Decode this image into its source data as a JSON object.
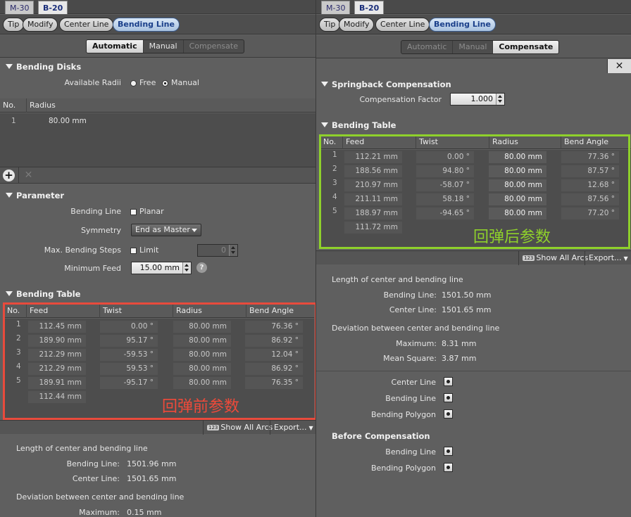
{
  "tabs": [
    "M-30",
    "B-20"
  ],
  "toolbar": [
    "Tip",
    "Modify",
    "Center Line",
    "Bending Line"
  ],
  "modes": [
    "Automatic",
    "Manual",
    "Compensate"
  ],
  "left": {
    "bending_disks": {
      "title": "Bending Disks",
      "available_radii_label": "Available Radii",
      "free_label": "Free",
      "manual_label": "Manual",
      "selected": "Manual",
      "columns": [
        "No.",
        "Radius"
      ],
      "rows": [
        {
          "no": "1",
          "radius": "80.00 mm"
        }
      ]
    },
    "parameter": {
      "title": "Parameter",
      "bending_line_label": "Bending Line",
      "planar_label": "Planar",
      "symmetry_label": "Symmetry",
      "symmetry_value": "End as Master",
      "max_steps_label": "Max. Bending Steps",
      "limit_label": "Limit",
      "limit_value": "0",
      "min_feed_label": "Minimum Feed",
      "min_feed_value": "15.00 mm",
      "help": "?"
    },
    "bending_table": {
      "title": "Bending Table",
      "columns": [
        "No.",
        "Feed",
        "Twist",
        "Radius",
        "Bend Angle"
      ],
      "rows": [
        {
          "no": "1",
          "feed": "112.45 mm",
          "twist": "0.00 °",
          "radius": "80.00 mm",
          "angle": "76.36 °"
        },
        {
          "no": "2",
          "feed": "189.90 mm",
          "twist": "95.17 °",
          "radius": "80.00 mm",
          "angle": "86.92 °"
        },
        {
          "no": "3",
          "feed": "212.29 mm",
          "twist": "-59.53 °",
          "radius": "80.00 mm",
          "angle": "12.04 °"
        },
        {
          "no": "4",
          "feed": "212.29 mm",
          "twist": "59.53 °",
          "radius": "80.00 mm",
          "angle": "86.92 °"
        },
        {
          "no": "5",
          "feed": "189.91 mm",
          "twist": "-95.17 °",
          "radius": "80.00 mm",
          "angle": "76.35 °"
        }
      ],
      "last_feed": "112.44 mm",
      "annotation": "回弹前参数"
    },
    "show_all_arcs": "Show All Arcs",
    "export": "Export...",
    "mini_icon": "123",
    "length": {
      "heading": "Length of center and bending line",
      "bending_line_label": "Bending Line:",
      "bending_line_value": "1501.96 mm",
      "center_line_label": "Center Line:",
      "center_line_value": "1501.65 mm"
    },
    "deviation": {
      "heading": "Deviation between center and bending line",
      "maximum_label": "Maximum:",
      "maximum_value": "0.15 mm"
    }
  },
  "right": {
    "springback": {
      "title": "Springback Compensation",
      "factor_label": "Compensation Factor",
      "factor_value": "1.000"
    },
    "bending_table": {
      "title": "Bending Table",
      "columns": [
        "No.",
        "Feed",
        "Twist",
        "Radius",
        "Bend Angle"
      ],
      "rows": [
        {
          "no": "1",
          "feed": "112.21 mm",
          "twist": "0.00 °",
          "radius": "80.00 mm",
          "angle": "77.36 °"
        },
        {
          "no": "2",
          "feed": "188.56 mm",
          "twist": "94.80 °",
          "radius": "80.00 mm",
          "angle": "87.57 °"
        },
        {
          "no": "3",
          "feed": "210.97 mm",
          "twist": "-58.07 °",
          "radius": "80.00 mm",
          "angle": "12.68 °"
        },
        {
          "no": "4",
          "feed": "211.11 mm",
          "twist": "58.18 °",
          "radius": "80.00 mm",
          "angle": "87.56 °"
        },
        {
          "no": "5",
          "feed": "188.97 mm",
          "twist": "-94.65 °",
          "radius": "80.00 mm",
          "angle": "77.20 °"
        }
      ],
      "last_feed": "111.72 mm",
      "annotation": "回弹后参数"
    },
    "show_all_arcs": "Show All Arcs",
    "export": "Export...",
    "mini_icon": "123",
    "length": {
      "heading": "Length of center and bending line",
      "bending_line_label": "Bending Line:",
      "bending_line_value": "1501.50 mm",
      "center_line_label": "Center Line:",
      "center_line_value": "1501.65 mm"
    },
    "deviation": {
      "heading": "Deviation between center and bending line",
      "maximum_label": "Maximum:",
      "maximum_value": "8.31 mm",
      "mean_square_label": "Mean Square:",
      "mean_square_value": "3.87 mm"
    },
    "visibility": {
      "center_line": "Center Line",
      "bending_line": "Bending Line",
      "bending_polygon": "Bending Polygon"
    },
    "before_compensation": {
      "title": "Before Compensation",
      "bending_line": "Bending Line",
      "bending_polygon": "Bending Polygon"
    },
    "close": "✕"
  }
}
